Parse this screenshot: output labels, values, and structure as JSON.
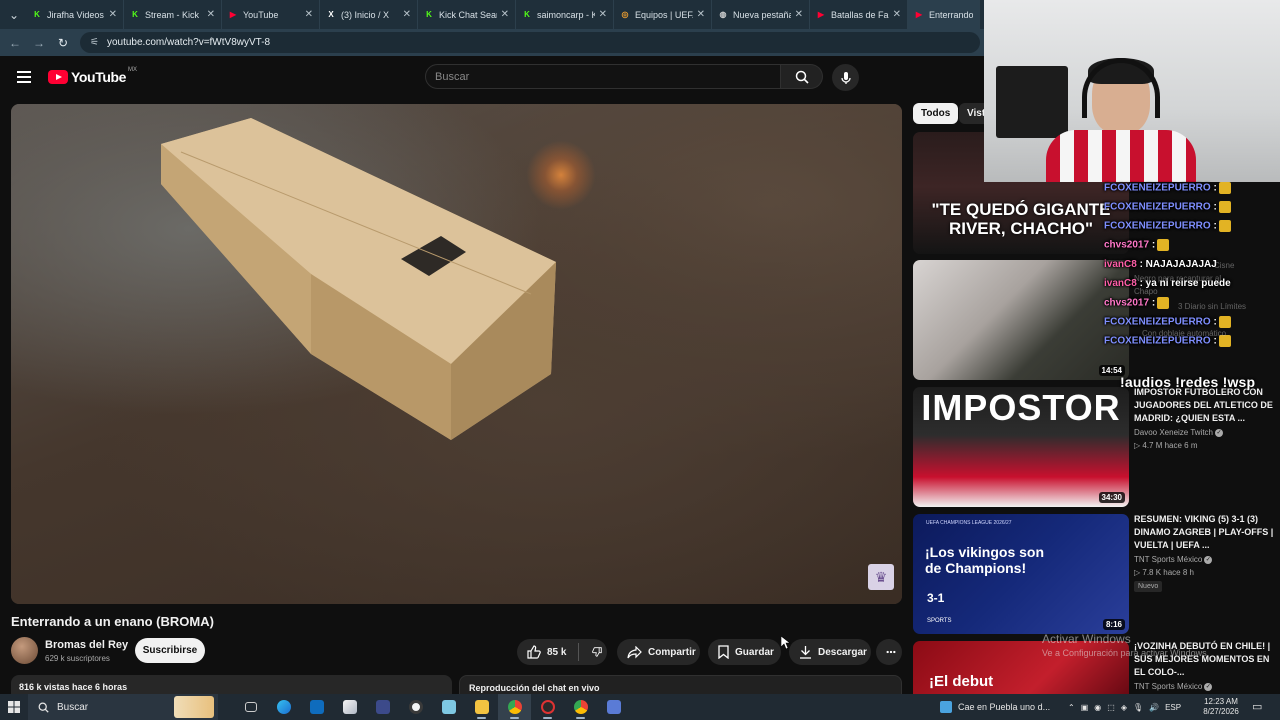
{
  "browser": {
    "tabs": [
      {
        "title": "Jirafha Videos",
        "fav_color": "#53fc18",
        "fav_glyph": "K"
      },
      {
        "title": "Stream - Kick",
        "fav_color": "#53fc18",
        "fav_glyph": "K"
      },
      {
        "title": "YouTube",
        "fav_color": "#ff0033",
        "fav_glyph": "▶"
      },
      {
        "title": "(3) Inicio / X",
        "fav_color": "#ffffff",
        "fav_glyph": "X"
      },
      {
        "title": "Kick Chat Search",
        "fav_color": "#53fc18",
        "fav_glyph": "K"
      },
      {
        "title": "saimoncarp - Kick",
        "fav_color": "#53fc18",
        "fav_glyph": "K"
      },
      {
        "title": "Equipos | UEFA",
        "fav_color": "#f0a030",
        "fav_glyph": "◎"
      },
      {
        "title": "Nueva pestaña",
        "fav_color": "#d0d0d0",
        "fav_glyph": "◍"
      },
      {
        "title": "Batallas de Fan",
        "fav_color": "#ff0033",
        "fav_glyph": "▶"
      },
      {
        "title": "Enterrando a un enano",
        "fav_color": "#ff0033",
        "fav_glyph": "▶"
      }
    ],
    "url": "youtube.com/watch?v=fWtV8wyVT-8"
  },
  "youtube": {
    "logo_text": "YouTube",
    "region": "MX",
    "search_placeholder": "Buscar"
  },
  "video": {
    "title": "Enterrando a un enano (BROMA)",
    "channel": "Bromas del Rey",
    "subscribers": "629 k suscriptores",
    "subscribe_label": "Suscribirse",
    "likes": "85 k",
    "share_label": "Compartir",
    "save_label": "Guardar",
    "download_label": "Descargar",
    "views_time": "816 k vistas  hace 6 horas",
    "chat_replay": "Reproducción del chat en vivo"
  },
  "chips": {
    "all": "Todos",
    "second": "Vist"
  },
  "sidebar": [
    {
      "thumb_text": "\"TE QUEDÓ GIGANTE RIVER, CHACHO\"",
      "duration": ""
    },
    {
      "thumb_text": "",
      "duration": "14:54"
    },
    {
      "thumb_text": "IMPOSTOR",
      "duration": "34:30",
      "title": "IMPOSTOR FUTBOLERO CON JUGADORES DEL ATLETICO DE MADRID: ¿QUIEN ESTA ...",
      "channel": "Davoo Xeneize Twitch",
      "meta": "▷ 4.7 M   hace 6 m"
    },
    {
      "thumb_small": "UEFA CHAMPIONS LEAGUE 2026/27",
      "thumb_text": "¡Los vikingos son de Champions!",
      "thumb_score": "3-1",
      "thumb_brand": "SPORTS",
      "duration": "8:16",
      "title": "RESUMEN: VIKING (5) 3-1 (3) DINAMO ZAGREB | PLAY-OFFS | VUELTA | UEFA ...",
      "channel": "TNT Sports México",
      "meta": "▷ 7.8 K   hace 8 h",
      "badge": "Nuevo"
    },
    {
      "thumb_text": "¡El debut",
      "title": "¡VOZINHA DEBUTÓ EN CHILE! | SUS MEJORES MOMENTOS EN EL COLO-...",
      "channel": "TNT Sports México"
    }
  ],
  "overlay": {
    "chat": [
      {
        "user": "FCOXENEIZEPUERRO",
        "text": " :",
        "color": "u-blue"
      },
      {
        "user": "FCOXENEIZEPUERRO",
        "text": " :",
        "color": "u-blue"
      },
      {
        "user": "FCOXENEIZEPUERRO",
        "text": " :",
        "color": "u-blue"
      },
      {
        "user": "chvs2017",
        "text": " :",
        "color": "u-pink2"
      },
      {
        "user": "ivanC8",
        "text": " : NAJAJAJAJAJ",
        "color": "u-pink"
      },
      {
        "user": "ivanC8",
        "text": " : ya ni reirse puede",
        "color": "u-pink"
      },
      {
        "user": "chvs2017",
        "text": " :",
        "color": "u-pink2"
      },
      {
        "user": "FCOXENEIZEPUERRO",
        "text": " :",
        "color": "u-blue"
      },
      {
        "user": "FCOXENEIZEPUERRO",
        "text": " :",
        "color": "u-blue"
      }
    ],
    "commands": "!audios !redes !wsp",
    "ghost_lines": [
      "Cisne",
      "Negro para recapturar al",
      "Chapo",
      "3 Diario sin Límites",
      "Con doblaje automático"
    ],
    "activate_title": "Activar Windows",
    "activate_sub": "Ve a Configuración para activar Windows."
  },
  "taskbar": {
    "search": "Buscar",
    "weather": "Cae en Puebla uno d...",
    "lang": "ESP",
    "time": "12:23 AM",
    "date": "8/27/2026"
  }
}
